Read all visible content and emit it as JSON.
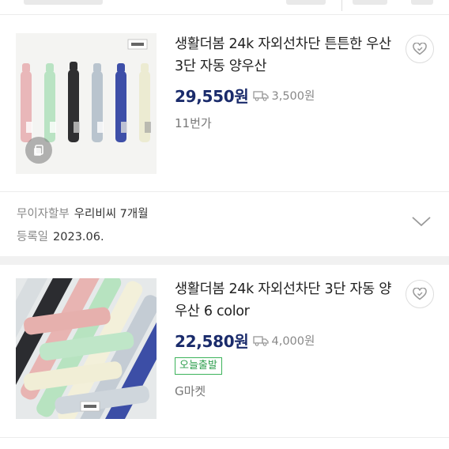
{
  "products": [
    {
      "title": "생활더봄 24k 자외선차단 튼튼한 우산 3단 자동 양우산",
      "price": "29,550원",
      "shipping": "3,500원",
      "mall": "11번가",
      "badge": "",
      "image_icon": "umbrella-lineup-image",
      "fav_icon": "heart-icon"
    },
    {
      "title": "생활더봄 24k 자외선차단 3단 자동 양우산 6 color",
      "price": "22,580원",
      "shipping": "4,000원",
      "mall": "G마켓",
      "badge": "오늘출발",
      "image_icon": "umbrella-pile-image",
      "fav_icon": "heart-icon"
    }
  ],
  "seller_info": {
    "installment_label": "무이자할부",
    "installment_value": "우리비씨 7개월",
    "registered_label": "등록일",
    "registered_value": "2023.06."
  },
  "colors": {
    "price": "#1a2b6b",
    "badge": "#2e9e4d",
    "muted": "#888888"
  }
}
